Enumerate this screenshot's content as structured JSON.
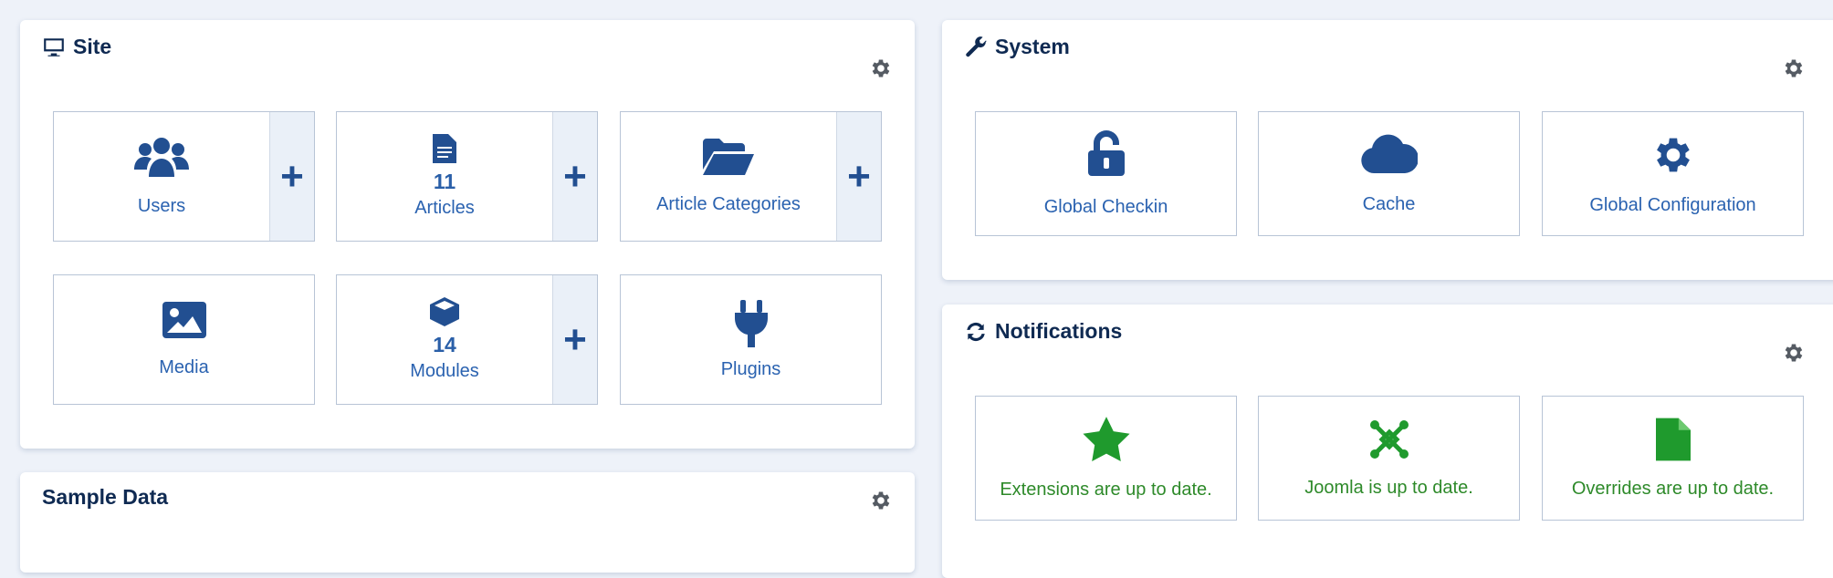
{
  "site": {
    "title": "Site",
    "tiles": [
      {
        "label": "Users",
        "count": "",
        "icon": "users-icon",
        "add": "+"
      },
      {
        "label": "Articles",
        "count": "11",
        "icon": "file-icon",
        "add": "+"
      },
      {
        "label": "Article Categories",
        "count": "",
        "icon": "folder-open-icon",
        "add": "+"
      },
      {
        "label": "Media",
        "count": "",
        "icon": "image-icon"
      },
      {
        "label": "Modules",
        "count": "14",
        "icon": "cube-icon",
        "add": "+"
      },
      {
        "label": "Plugins",
        "count": "",
        "icon": "plug-icon"
      }
    ]
  },
  "system": {
    "title": "System",
    "tiles": [
      {
        "label": "Global Checkin",
        "icon": "unlock-icon"
      },
      {
        "label": "Cache",
        "icon": "cloud-icon"
      },
      {
        "label": "Global Configuration",
        "icon": "gear-icon"
      }
    ]
  },
  "notifications": {
    "title": "Notifications",
    "tiles": [
      {
        "label": "Extensions are up to date.",
        "icon": "star-icon"
      },
      {
        "label": "Joomla is up to date.",
        "icon": "joomla-icon"
      },
      {
        "label": "Overrides are up to date.",
        "icon": "file-icon"
      }
    ]
  },
  "sample_data": {
    "title": "Sample Data"
  },
  "colors": {
    "accent": "#224f91",
    "link": "#2a62b0",
    "success": "#2e8a2a",
    "background": "#eef2f9"
  }
}
